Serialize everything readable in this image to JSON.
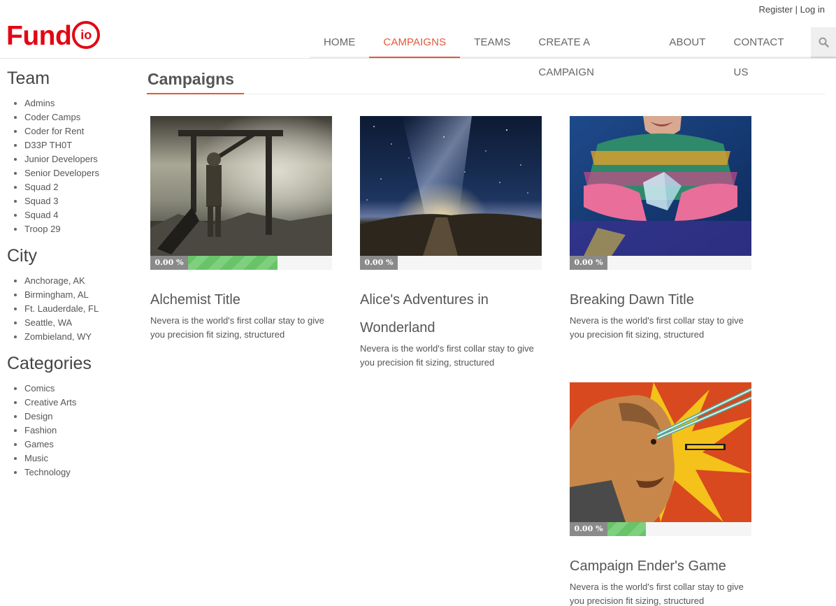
{
  "auth": {
    "register": "Register",
    "separator": "|",
    "login": "Log in"
  },
  "logo": {
    "text": "Fund",
    "circle_text": "io",
    "color": "#e30613"
  },
  "nav": {
    "items": [
      "HOME",
      "CAMPAIGNS",
      "TEAMS",
      "CREATE A CAMPAIGN",
      "ABOUT",
      "CONTACT US"
    ],
    "active": "CAMPAIGNS",
    "search_icon": "search-icon"
  },
  "sidebar": {
    "team": {
      "title": "Team",
      "items": [
        "Admins",
        "Coder Camps",
        "Coder for Rent",
        "D33P TH0T",
        "Junior Developers",
        "Senior Developers",
        "Squad 2",
        "Squad 3",
        "Squad 4",
        "Troop 29"
      ]
    },
    "city": {
      "title": "City",
      "items": [
        "Anchorage, AK",
        "Birmingham, AL",
        "Ft. Lauderdale, FL",
        "Seattle, WA",
        "Zombieland, WY"
      ]
    },
    "categories": {
      "title": "Categories",
      "items": [
        "Comics",
        "Creative Arts",
        "Design",
        "Fashion",
        "Games",
        "Music",
        "Technology"
      ]
    }
  },
  "main": {
    "title": "Campaigns",
    "accent_color": "#e05a3c",
    "campaigns": [
      {
        "title": "Alchemist Title",
        "title_line2": "",
        "progress_text": "0.00 %",
        "bar_fill": 0.7,
        "description": "Nevera is the world's first collar stay to give you precision fit sizing, structured",
        "image": "post-apocalyptic-soldier-image"
      },
      {
        "title": "Alice's Adventures in",
        "title_line2": "Wonderland",
        "progress_text": "0.00 %",
        "bar_fill": 0.0,
        "description": "Nevera is the world's first collar stay to give you precision fit sizing, structured",
        "image": "milky-way-night-sky-image"
      },
      {
        "title": "Breaking Dawn Title",
        "title_line2": "",
        "progress_text": "0.00 %",
        "bar_fill": 0.0,
        "description": "Nevera is the world's first collar stay to give you precision fit sizing, structured",
        "image": "neon-hands-cube-image"
      },
      {
        "title": "Campaign Ender's Game",
        "title_line2": "",
        "progress_text": "0.00 %",
        "bar_fill": 0.42,
        "description": "Nevera is the world's first collar stay to give you precision fit sizing, structured",
        "image": "comic-laser-eyes-image"
      }
    ]
  }
}
